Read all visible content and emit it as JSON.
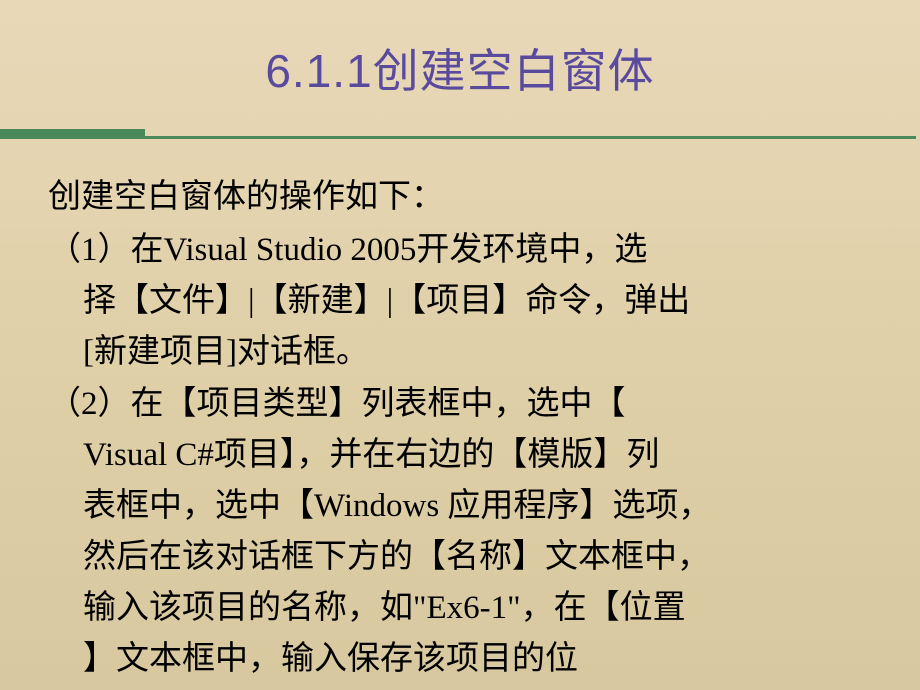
{
  "slide": {
    "title": "6.1.1创建空白窗体",
    "intro": "创建空白窗体的操作如下：",
    "item1_line1": "（1）在Visual Studio 2005开发环境中，选",
    "item1_line2": "择【文件】|【新建】|【项目】命令，弹出",
    "item1_line3": "[新建项目]对话框。",
    "item2_line1": "（2）在【项目类型】列表框中，选中【",
    "item2_line2": "Visual C#项目】，并在右边的【模版】列",
    "item2_line3": "表框中，选中【Windows 应用程序】选项，",
    "item2_line4": "然后在该对话框下方的【名称】文本框中，",
    "item2_line5": "输入该项目的名称，如\"Ex6-1\"，在【位置",
    "item2_line6": "】文本框中，输入保存该项目的位"
  }
}
